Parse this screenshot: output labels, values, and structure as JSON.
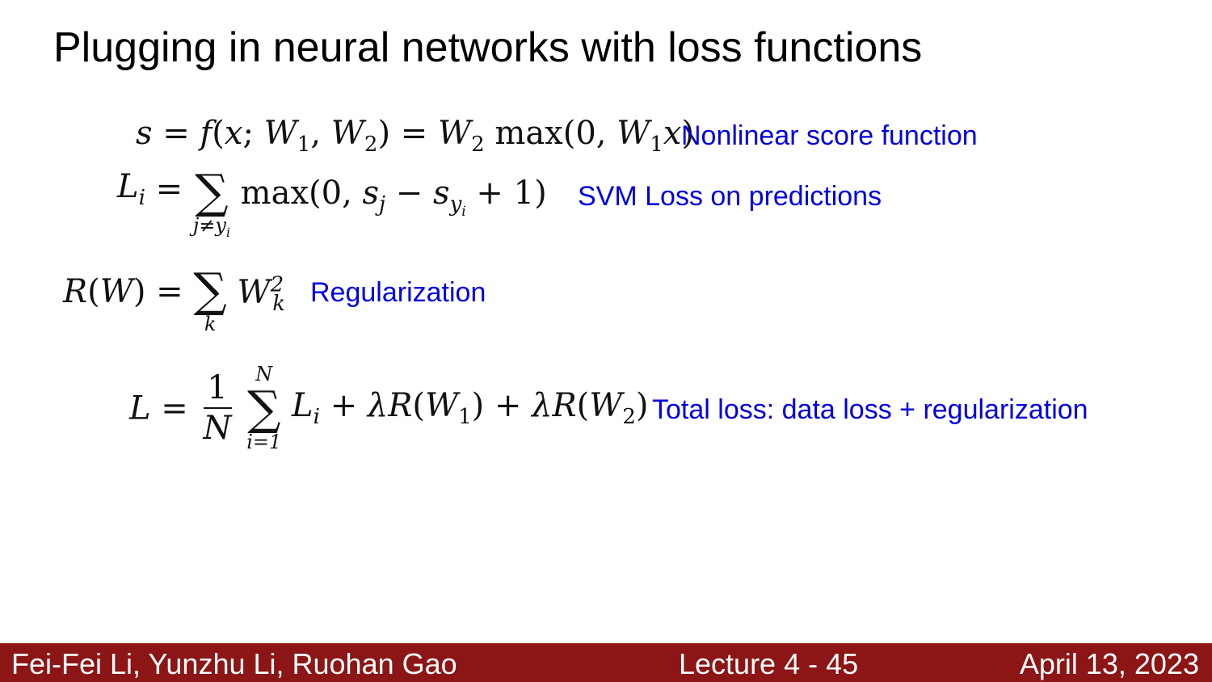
{
  "slide": {
    "title": "Plugging in neural networks with loss functions",
    "annotation_color": "#0000e0",
    "equations": [
      {
        "id": "score",
        "annotation": "Nonlinear score function"
      },
      {
        "id": "svm",
        "annotation": "SVM Loss on predictions"
      },
      {
        "id": "reg",
        "annotation": "Regularization"
      },
      {
        "id": "total",
        "annotation": "Total loss: data loss + regularization"
      }
    ]
  },
  "footer": {
    "background": "#8c1515",
    "authors": "Fei-Fei Li, Yunzhu Li, Ruohan Gao",
    "lecture": "Lecture 4 - 45",
    "date": "April 13, 2023"
  }
}
